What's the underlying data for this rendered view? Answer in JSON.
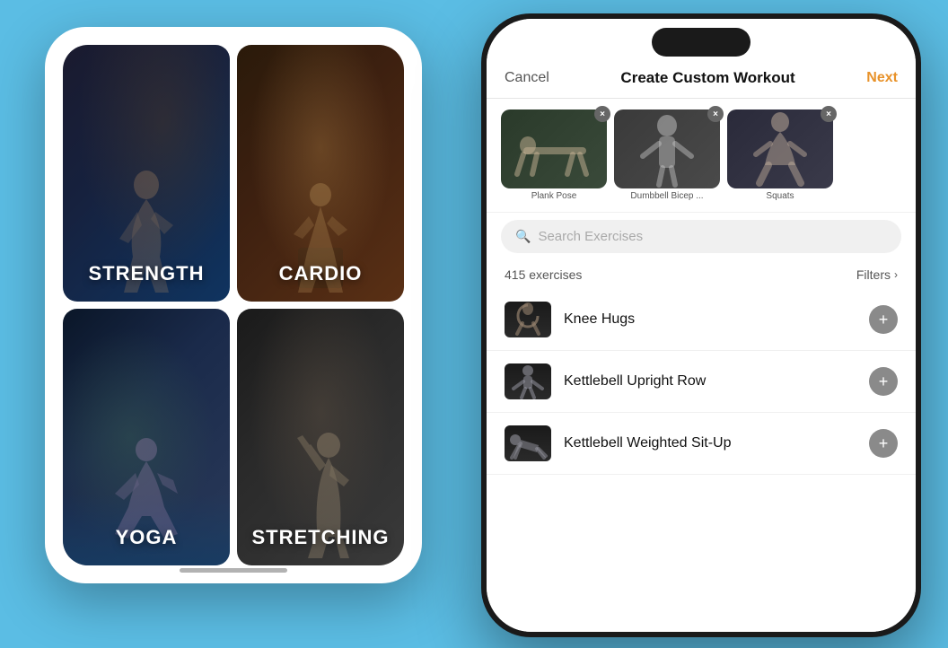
{
  "background_color": "#5bbde4",
  "left_phone": {
    "categories": [
      {
        "id": "strength",
        "label": "STRENGTH",
        "bg": "dark-body"
      },
      {
        "id": "cardio",
        "label": "CARDIO",
        "bg": "dark-box"
      },
      {
        "id": "yoga",
        "label": "YOGA",
        "bg": "dark-yoga"
      },
      {
        "id": "stretching",
        "label": "STRETCHING",
        "bg": "dark-stretch"
      }
    ]
  },
  "right_phone": {
    "nav": {
      "cancel": "Cancel",
      "title": "Create Custom Workout",
      "next": "Next"
    },
    "selected_exercises": [
      {
        "name": "Plank Pose",
        "label": "Plank Pose"
      },
      {
        "name": "Dumbbell Bicep ...",
        "label": "Dumbbell Bicep ..."
      },
      {
        "name": "Squats",
        "label": "Squats"
      }
    ],
    "search": {
      "placeholder": "Search Exercises",
      "icon": "🔍"
    },
    "exercises_count": "415 exercises",
    "filters_label": "Filters",
    "exercise_list": [
      {
        "name": "Knee Hugs"
      },
      {
        "name": "Kettlebell Upright Row"
      },
      {
        "name": "Kettlebell Weighted Sit-Up"
      }
    ]
  }
}
